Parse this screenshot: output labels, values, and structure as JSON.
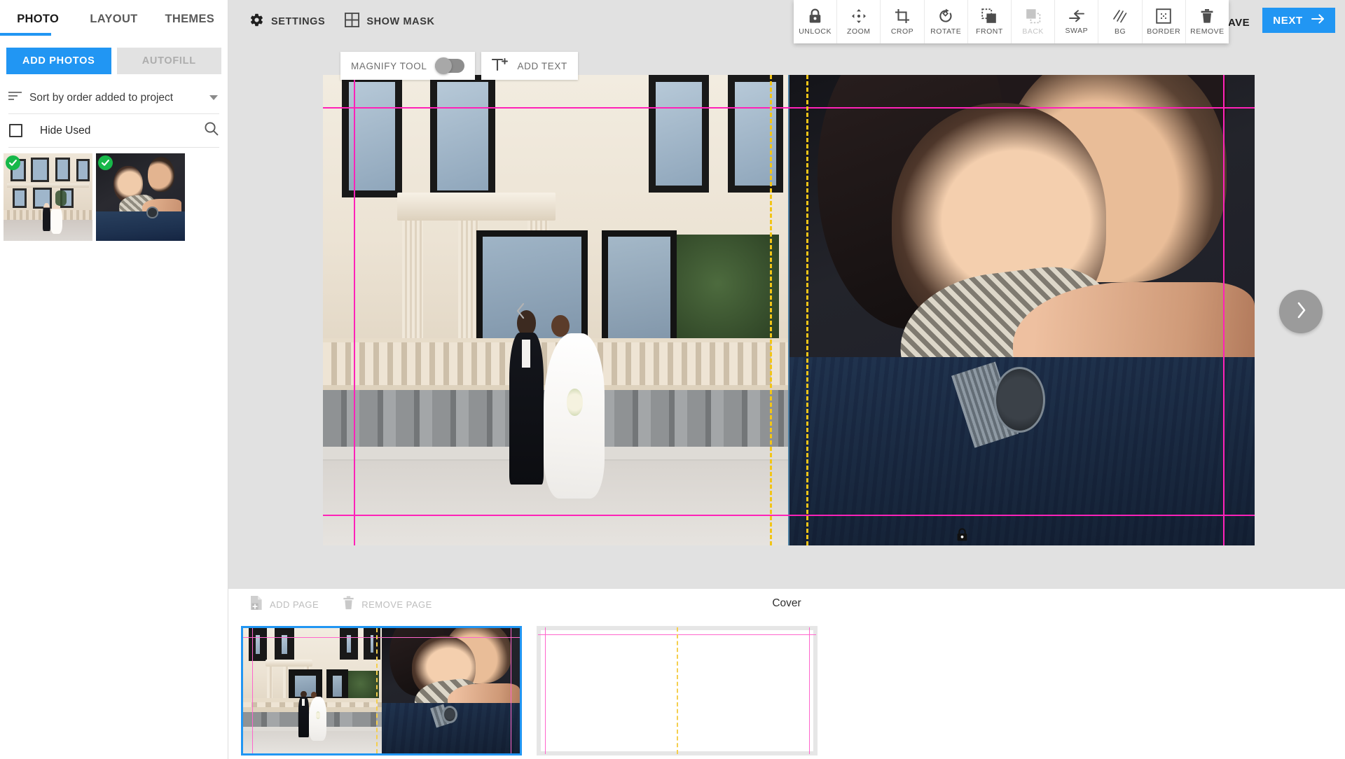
{
  "sidebar": {
    "tabs": [
      {
        "label": "PHOTO",
        "active": true
      },
      {
        "label": "LAYOUT",
        "active": false
      },
      {
        "label": "THEMES",
        "active": false
      }
    ],
    "add_photos_label": "ADD PHOTOS",
    "autofill_label": "AUTOFILL",
    "autofill_disabled": true,
    "sort_label": "Sort by order added to project",
    "hide_used_label": "Hide Used",
    "hide_used_checked": false,
    "search_icon": "search-icon",
    "photos": [
      {
        "name": "wedding-couple-mansion",
        "used": true
      },
      {
        "name": "couple-embrace-closeup",
        "used": true
      }
    ]
  },
  "topbar": {
    "settings_label": "SETTINGS",
    "settings_icon": "gear-icon",
    "show_mask_label": "SHOW MASK",
    "show_mask_icon": "grid-icon",
    "save_label": "SAVE",
    "save_icon": "floppy-disk-icon",
    "next_label": "NEXT",
    "next_icon": "arrow-right-icon",
    "accent_color": "#2196f3"
  },
  "tools": [
    {
      "label": "UNLOCK",
      "icon": "lock-icon",
      "disabled": false
    },
    {
      "label": "ZOOM",
      "icon": "move-icon",
      "disabled": false
    },
    {
      "label": "CROP",
      "icon": "crop-icon",
      "disabled": false
    },
    {
      "label": "ROTATE",
      "icon": "rotate-icon",
      "disabled": false
    },
    {
      "label": "FRONT",
      "icon": "bring-front-icon",
      "disabled": false
    },
    {
      "label": "BACK",
      "icon": "send-back-icon",
      "disabled": true
    },
    {
      "label": "SWAP",
      "icon": "swap-icon",
      "disabled": false
    },
    {
      "label": "BG",
      "icon": "hatch-bg-icon",
      "disabled": false
    },
    {
      "label": "BORDER",
      "icon": "border-icon",
      "disabled": false
    },
    {
      "label": "REMOVE",
      "icon": "trash-icon",
      "disabled": false
    }
  ],
  "subbar": {
    "magnify_label": "MAGNIFY TOOL",
    "magnify_on": false,
    "add_text_label": "ADD TEXT",
    "add_text_icon": "text-plus-icon"
  },
  "canvas": {
    "prev_icon": "chevron-left-icon",
    "next_icon": "chevron-right-icon",
    "lock_icon": "lock-icon",
    "guide_color": "#ff22b8",
    "fold_guide_color": "#f2c517"
  },
  "pagepanel": {
    "add_page_label": "ADD PAGE",
    "add_page_icon": "file-plus-icon",
    "add_page_disabled": true,
    "remove_page_label": "REMOVE PAGE",
    "remove_page_icon": "trash-icon",
    "remove_page_disabled": true,
    "title": "Cover",
    "pages": [
      {
        "name": "cover-spread",
        "selected": true,
        "empty": false
      },
      {
        "name": "inside-spread",
        "selected": false,
        "empty": true
      }
    ]
  }
}
